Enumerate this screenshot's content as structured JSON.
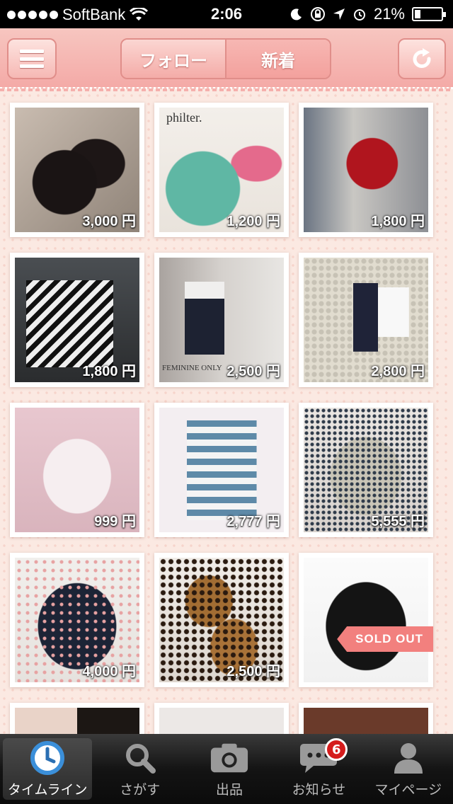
{
  "status_bar": {
    "carrier": "SoftBank",
    "time": "2:06",
    "battery_text": "21%",
    "battery_level": 0.21
  },
  "nav": {
    "tabs": [
      {
        "label": "フォロー"
      },
      {
        "label": "新着"
      }
    ],
    "menu_icon": "hamburger-icon",
    "refresh_icon": "refresh-icon"
  },
  "items": [
    {
      "price": "3,000 円",
      "photo": "black heeled pumps"
    },
    {
      "price": "1,200 円",
      "photo": "mint green knit top",
      "brand": "philter."
    },
    {
      "price": "1,800 円",
      "photo": "red cardigan outfit"
    },
    {
      "price": "1,800 円",
      "photo": "striped jacket"
    },
    {
      "price": "2,500 円",
      "photo": "black white dress",
      "brand": "FEMININE ONLY"
    },
    {
      "price": "2,800 円",
      "photo": "lace item with tags"
    },
    {
      "price": "999 円",
      "photo": "pink lace blouse"
    },
    {
      "price": "2,777 円",
      "photo": "striped dress"
    },
    {
      "price": "5,555 円",
      "photo": "floral jacket"
    },
    {
      "price": "4,000 円",
      "photo": "floral top"
    },
    {
      "price": "2,500 円",
      "photo": "leopard loafers"
    },
    {
      "price": "",
      "photo": "black knit top",
      "sold_label": "SOLD OUT"
    },
    {
      "price": "",
      "photo": "partial item"
    },
    {
      "price": "",
      "photo": "partial item"
    },
    {
      "price": "",
      "photo": "partial item"
    }
  ],
  "tabbar": {
    "tabs": [
      {
        "label": "タイムライン",
        "icon": "clock-icon",
        "active": true
      },
      {
        "label": "さがす",
        "icon": "search-icon"
      },
      {
        "label": "出品",
        "icon": "camera-icon"
      },
      {
        "label": "お知らせ",
        "icon": "chat-icon",
        "badge": "6"
      },
      {
        "label": "マイページ",
        "icon": "person-icon"
      }
    ]
  }
}
